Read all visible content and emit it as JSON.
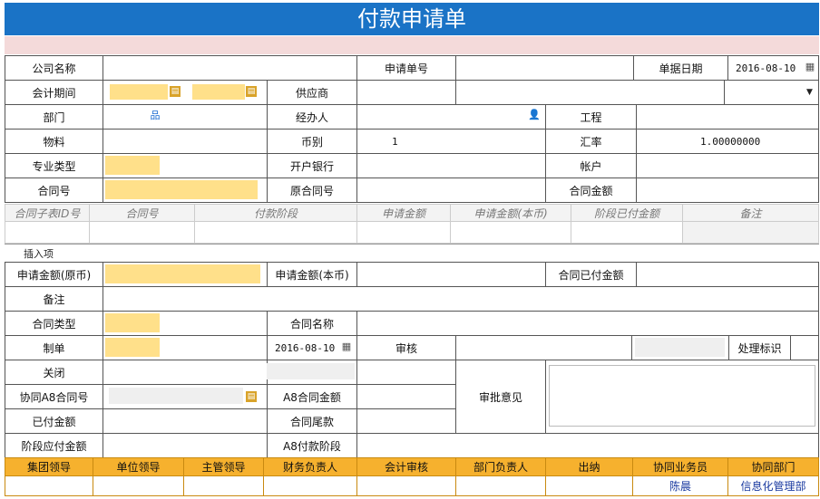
{
  "title": "付款申请单",
  "header": {
    "company_name_label": "公司名称",
    "request_no_label": "申请单号",
    "doc_date_label": "单据日期",
    "doc_date_value": "2016-08-10",
    "period_label": "会计期间",
    "supplier_label": "供应商",
    "dept_label": "部门",
    "handler_label": "经办人",
    "project_label": "工程",
    "material_label": "物料",
    "currency_label": "币别",
    "currency_value": "1",
    "rate_label": "汇率",
    "rate_value": "1.00000000",
    "prof_type_label": "专业类型",
    "bank_label": "开户银行",
    "account_label": "帐户",
    "contract_no_label": "合同号",
    "orig_contract_label": "原合同号",
    "contract_amount_label": "合同金额"
  },
  "grid": {
    "columns": [
      "合同子表ID号",
      "合同号",
      "付款阶段",
      "申请金额",
      "申请金额(本币)",
      "阶段已付金额",
      "备注"
    ],
    "insert_label": "插入项"
  },
  "details": {
    "apply_amount_orig_label": "申请金额(原币)",
    "apply_amount_local_label": "申请金额(本币)",
    "contract_paid_label": "合同已付金额",
    "remark_label": "备注",
    "contract_type_label": "合同类型",
    "contract_name_label": "合同名称",
    "maker_label": "制单",
    "maker_date_value": "2016-08-10",
    "review_label": "审核",
    "process_flag_label": "处理标识",
    "close_label": "关闭",
    "a8_contract_no_label": "协同A8合同号",
    "a8_contract_amount_label": "A8合同金额",
    "approval_opinion_label": "审批意见",
    "paid_amount_label": "已付金额",
    "contract_tail_label": "合同尾款",
    "stage_payable_label": "阶段应付金额",
    "a8_pay_stage_label": "A8付款阶段"
  },
  "signatures": {
    "headers": [
      "集团领导",
      "单位领导",
      "主管领导",
      "财务负责人",
      "会计审核",
      "部门负责人",
      "出纳",
      "协同业务员",
      "协同部门"
    ],
    "values": [
      "",
      "",
      "",
      "",
      "",
      "",
      "",
      "陈晨",
      "信息化管理部"
    ]
  },
  "icons": {
    "calendar": "▦",
    "org": "品",
    "user": "👤",
    "picker": "▤",
    "dropdown": "▼"
  },
  "colors": {
    "title_bg": "#1a73c6",
    "required_field": "#ffe08a",
    "signature_header": "#f6b12e",
    "pink_strip": "#f4dada"
  }
}
